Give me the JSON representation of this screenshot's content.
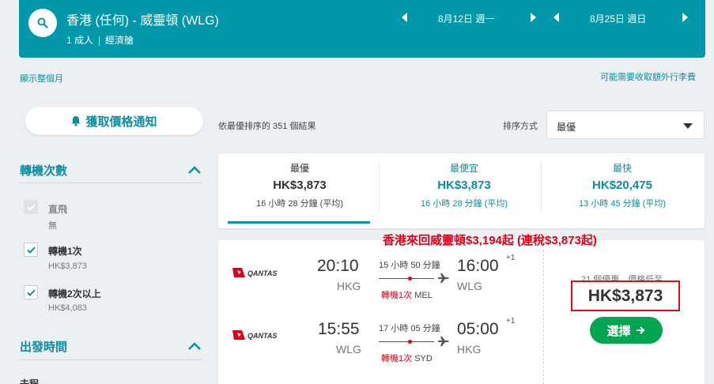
{
  "header": {
    "route": "香港 (任何) - 威靈頓 (WLG)",
    "passengers": "1 成人",
    "cabin": "經濟艙",
    "depart_date": "8月12日 週一",
    "return_date": "8月25日 週日"
  },
  "links": {
    "show_month": "顯示整個月",
    "baggage_fees": "可能需要收取額外行李費"
  },
  "sidebar": {
    "price_alert": "獲取價格通知",
    "stops_title": "轉機次數",
    "stops": [
      {
        "label": "直飛",
        "price": "無",
        "checked": false,
        "disabled": true
      },
      {
        "label": "轉機1次",
        "price": "HK$3,873",
        "checked": true,
        "disabled": false
      },
      {
        "label": "轉機2次以上",
        "price": "HK$4,083",
        "checked": true,
        "disabled": false
      }
    ],
    "departure_title": "出發時間",
    "departure_sub": "去程"
  },
  "results": {
    "count_text": "依最優排序的 351 個結果",
    "sort_label": "排序方式",
    "sort_value": "最優"
  },
  "tabs": [
    {
      "label": "最優",
      "price": "HK$3,873",
      "detail": "16 小時 28 分鐘 (平均)"
    },
    {
      "label": "最便宜",
      "price": "HK$3,873",
      "detail": "16 小時 28 分鐘 (平均)"
    },
    {
      "label": "最快",
      "price": "HK$20,475",
      "detail": "13 小時 45 分鐘 (平均)"
    }
  ],
  "promo": "香港來回威靈頓$3,194起 (連稅$3,873起)",
  "itinerary": {
    "legs": [
      {
        "airline": "QANTAS",
        "depart_time": "20:10",
        "depart_code": "HKG",
        "duration": "15 小時 50 分鐘",
        "stops": "轉機1次",
        "via": "MEL",
        "arrive_time": "16:00",
        "arrive_code": "WLG",
        "day_offset": "+1"
      },
      {
        "airline": "QANTAS",
        "depart_time": "15:55",
        "depart_code": "WLG",
        "duration": "17 小時 05 分鐘",
        "stops": "轉機1次",
        "via": "SYD",
        "arrive_time": "05:00",
        "arrive_code": "HKG",
        "day_offset": "+1"
      }
    ],
    "deals_text": "21 個優惠，價格低至",
    "price": "HK$3,873",
    "select_label": "選擇"
  },
  "colors": {
    "brand": "#0098aa",
    "accent_link": "#0a8ea0",
    "promo_red": "#e0001b",
    "select_green": "#00a651"
  },
  "icons": {
    "search": "search-icon",
    "bell": "bell-icon",
    "chevron": "chevron-up-icon",
    "prev": "arrow-left-icon",
    "next": "arrow-right-icon",
    "plane": "plane-icon"
  }
}
